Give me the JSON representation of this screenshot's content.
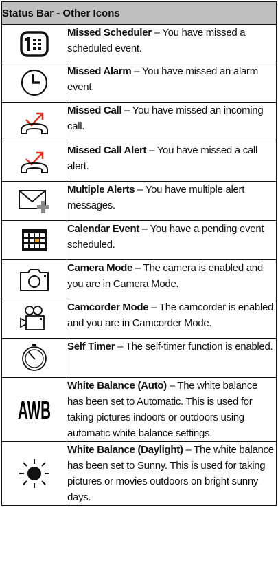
{
  "table": {
    "header": "Status Bar - Other Icons",
    "rows": [
      {
        "icon": "missed-scheduler-icon",
        "title": "Missed Scheduler",
        "text": " – You have missed a scheduled event."
      },
      {
        "icon": "missed-alarm-icon",
        "title": "Missed Alarm",
        "text": " – You have missed an alarm event."
      },
      {
        "icon": "missed-call-icon",
        "title": "Missed Call",
        "text": " – You have missed an incoming call."
      },
      {
        "icon": "missed-call-alert-icon",
        "title": "Missed Call Alert",
        "text": " – You have missed a call alert."
      },
      {
        "icon": "multiple-alerts-icon",
        "title": "Multiple Alerts",
        "text": " – You have multiple alert messages."
      },
      {
        "icon": "calendar-event-icon",
        "title": "Calendar Event",
        "text": " – You have a pending event scheduled."
      },
      {
        "icon": "camera-mode-icon",
        "title": "Camera Mode",
        "text": " – The camera is enabled and you are in Camera Mode."
      },
      {
        "icon": "camcorder-mode-icon",
        "title": "Camcorder Mode",
        "text": " – The camcorder is enabled and you are in Camcorder Mode."
      },
      {
        "icon": "self-timer-icon",
        "title": "Self Timer",
        "text": " – The self-timer function is enabled."
      },
      {
        "icon": "awb-icon",
        "icon_text": "AWB",
        "title": "White Balance (Auto)",
        "text": " – The white balance has been set to Automatic. This is used for taking pictures indoors or outdoors using automatic white balance settings."
      },
      {
        "icon": "sun-icon",
        "title": "White Balance (Daylight)",
        "text": " – The white balance has been set to Sunny. This is used for taking pictures or movies outdoors on bright sunny days."
      }
    ]
  },
  "colors": {
    "header_bg": "#bfbfbf",
    "missed_red": "#e0311f",
    "calendar_orange": "#f0a020",
    "plus_gray": "#8a8a8a"
  }
}
